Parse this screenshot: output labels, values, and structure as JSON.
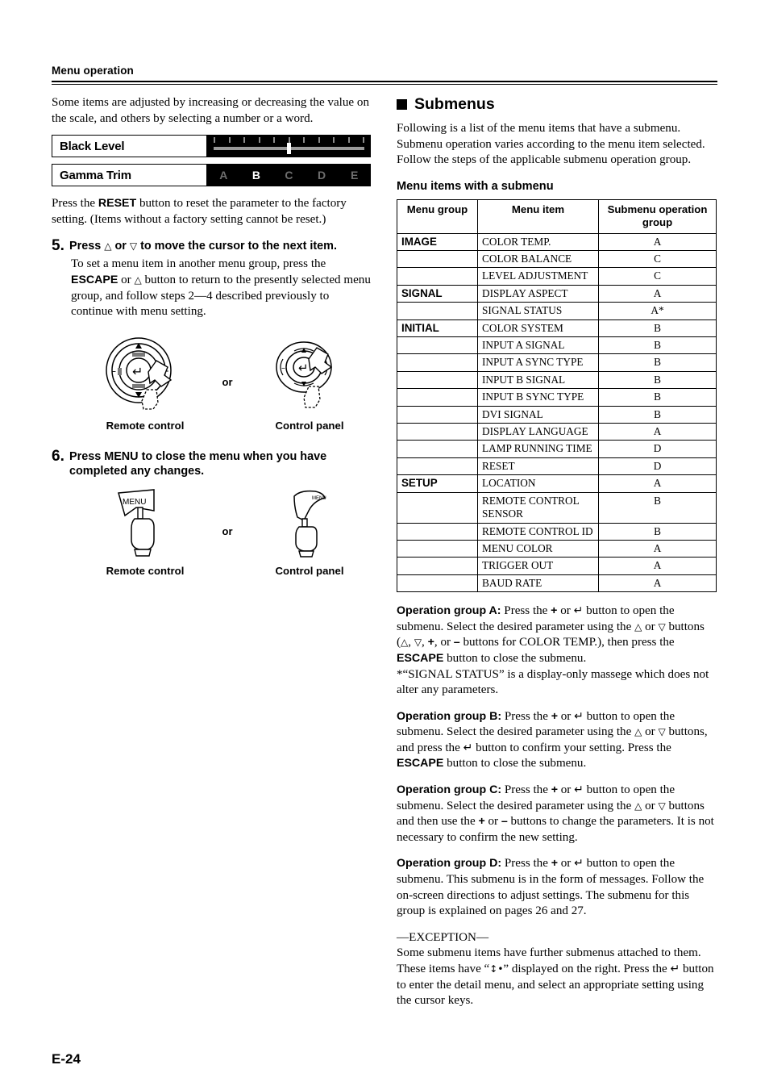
{
  "header": {
    "title": "Menu operation"
  },
  "left": {
    "intro": "Some items are adjusted by increasing or decreasing the value on the scale, and others by selecting a number or a word.",
    "osd": {
      "rows": [
        {
          "label": "Black Level",
          "type": "slider",
          "thumb_percent": 49,
          "tick_count": 11
        },
        {
          "label": "Gamma Trim",
          "type": "steps",
          "steps": [
            "A",
            "B",
            "C",
            "D",
            "E"
          ],
          "selected": "B"
        }
      ]
    },
    "reset_note_a": "Press the ",
    "reset_note_b": "RESET",
    "reset_note_c": " button to reset the parameter to the factory setting. (Items without a factory setting cannot be reset.)",
    "step5": {
      "number": "5.",
      "title_a": "Press ",
      "title_up": "△",
      "title_b": " or ",
      "title_down": "▽",
      "title_c": " to move the cursor to the next item.",
      "body_a": "To set a menu item in another menu group, press the ",
      "body_bold": "ESCAPE",
      "body_b": " or ",
      "body_up": "△",
      "body_c": " button to return to the presently selected menu group, and follow steps 2—4 described previously to continue with menu setting.",
      "illus": {
        "or_label": "or",
        "left_caption": "Remote control",
        "right_caption": "Control panel",
        "pad_up": "△",
        "pad_down": "▽",
        "pad_minus": "–",
        "pad_plus": "+",
        "pad_enter": "↵"
      }
    },
    "step6": {
      "number": "6.",
      "title": "Press MENU to close the menu when you have completed any changes.",
      "illus": {
        "or_label": "or",
        "left_caption": "Remote control",
        "right_caption": "Control panel",
        "menu_label": "MENU"
      }
    }
  },
  "right": {
    "section_title": "Submenus",
    "intro": "Following is a list of the menu items that have a submenu. Submenu operation varies according to the menu item selected. Follow the steps of the applicable submenu operation group.",
    "table_title": "Menu items with a submenu",
    "table": {
      "columns": [
        "Menu group",
        "Menu item",
        "Submenu operation group"
      ],
      "rows": [
        {
          "group": "IMAGE",
          "item": "COLOR TEMP.",
          "op": "A"
        },
        {
          "group": "",
          "item": "COLOR BALANCE",
          "op": "C"
        },
        {
          "group": "",
          "item": "LEVEL ADJUSTMENT",
          "op": "C"
        },
        {
          "group": "SIGNAL",
          "item": "DISPLAY ASPECT",
          "op": "A"
        },
        {
          "group": "",
          "item": "SIGNAL STATUS",
          "op": "A*"
        },
        {
          "group": "INITIAL",
          "item": "COLOR SYSTEM",
          "op": "B"
        },
        {
          "group": "",
          "item": "INPUT A SIGNAL",
          "op": "B"
        },
        {
          "group": "",
          "item": "INPUT A SYNC TYPE",
          "op": "B"
        },
        {
          "group": "",
          "item": "INPUT B SIGNAL",
          "op": "B"
        },
        {
          "group": "",
          "item": "INPUT B SYNC TYPE",
          "op": "B"
        },
        {
          "group": "",
          "item": "DVI SIGNAL",
          "op": "B"
        },
        {
          "group": "",
          "item": "DISPLAY LANGUAGE",
          "op": "A"
        },
        {
          "group": "",
          "item": "LAMP RUNNING TIME",
          "op": "D"
        },
        {
          "group": "",
          "item": "RESET",
          "op": "D"
        },
        {
          "group": "SETUP",
          "item": "LOCATION",
          "op": "A"
        },
        {
          "group": "",
          "item": "REMOTE CONTROL SENSOR",
          "op": "B"
        },
        {
          "group": "",
          "item": "REMOTE CONTROL ID",
          "op": "B"
        },
        {
          "group": "",
          "item": "MENU COLOR",
          "op": "A"
        },
        {
          "group": "",
          "item": "TRIGGER OUT",
          "op": "A"
        },
        {
          "group": "",
          "item": "BAUD RATE",
          "op": "A"
        }
      ]
    },
    "group_a": {
      "label": "Operation group A:",
      "t1": " Press the ",
      "plus": "+",
      "t2": " or ",
      "enter": "↵",
      "t3": " button to open the submenu. Select the desired parameter using the ",
      "up": "△",
      "t4": " or ",
      "down": "▽",
      "t5": " buttons (",
      "t6": ", ",
      "t7": ", or ",
      "minus": "–",
      "t8": " buttons for COLOR TEMP.), then press the ",
      "escape": "ESCAPE",
      "t9": " button to close the submenu.",
      "note": "*“SIGNAL STATUS” is a display-only massege which does not alter any parameters."
    },
    "group_b": {
      "label": "Operation group B:",
      "t1": " Press the ",
      "plus": "+",
      "t2": " or ",
      "enter": "↵",
      "t3": " button to open the submenu. Select the desired parameter using the ",
      "up": "△",
      "t4": " or ",
      "down": "▽",
      "t5": " buttons, and press the ",
      "t6": " button to confirm your setting. Press the ",
      "escape": "ESCAPE",
      "t7": " button to close the submenu."
    },
    "group_c": {
      "label": "Operation group C:",
      "t1": " Press the ",
      "plus": "+",
      "t2": " or ",
      "enter": "↵",
      "t3": " button to open the submenu. Select the desired parameter using the ",
      "up": "△",
      "t4": " or ",
      "down": "▽",
      "t5": " buttons and then use the ",
      "t6": " or ",
      "minus": "–",
      "t7": " buttons to change the parameters. It is not necessary to confirm the new setting."
    },
    "group_d": {
      "label": "Operation group D:",
      "t1": " Press the ",
      "plus": "+",
      "t2": " or ",
      "enter": "↵",
      "t3": " button to open the submenu. This submenu is in the form of messages. Follow the on-screen directions to adjust settings. The submenu for this group is explained on pages 26 and 27."
    },
    "exception": {
      "title": "—EXCEPTION—",
      "t1": "Some submenu items have further submenus attached to them. These items have “",
      "symbol": "↕•",
      "t2": "” displayed on the right. Press the ",
      "enter": "↵",
      "t3": " button to enter the detail menu, and select an appropriate setting using the cursor keys."
    }
  },
  "footer": {
    "page": "E-24"
  }
}
